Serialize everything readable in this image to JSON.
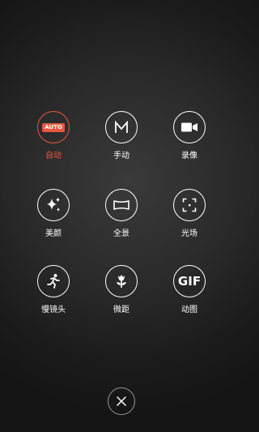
{
  "modes": [
    {
      "label": "自动",
      "icon": "auto-icon",
      "badge": "AUTO",
      "active": true
    },
    {
      "label": "手动",
      "icon": "manual-m-icon",
      "active": false
    },
    {
      "label": "录像",
      "icon": "video-camera-icon",
      "active": false
    },
    {
      "label": "美颜",
      "icon": "sparkle-icon",
      "active": false
    },
    {
      "label": "全景",
      "icon": "panorama-icon",
      "active": false
    },
    {
      "label": "光场",
      "icon": "focus-frame-icon",
      "active": false
    },
    {
      "label": "慢镜头",
      "icon": "running-person-icon",
      "active": false
    },
    {
      "label": "微距",
      "icon": "flower-icon",
      "active": false
    },
    {
      "label": "动图",
      "icon": "gif-icon",
      "badge": "GIF",
      "active": false
    }
  ],
  "close_icon": "close-icon",
  "colors": {
    "accent": "#e8573f",
    "foreground": "#ffffff"
  }
}
